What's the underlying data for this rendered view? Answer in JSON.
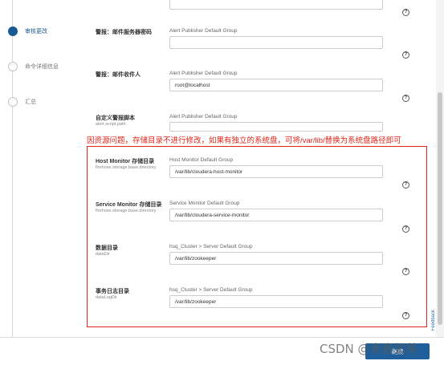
{
  "stepper": {
    "steps": [
      {
        "label": "审核更改",
        "active": true
      },
      {
        "label": "命令详细信息",
        "active": false
      },
      {
        "label": "汇总",
        "active": false
      }
    ]
  },
  "config": {
    "top_field_value": "",
    "email_server": {
      "label": "警报：邮件服务器密码",
      "group": "Alert Publisher Default Group",
      "value": ""
    },
    "email_recipient": {
      "label": "警报：邮件收件人",
      "group": "Alert Publisher Default Group",
      "value": "root@localhost"
    },
    "custom_script": {
      "label": "自定义警报脚本",
      "sublabel": "alert.script.path",
      "group": "Alert Publisher Default Group"
    },
    "host_monitor": {
      "label": "Host Monitor 存储目录",
      "sublabel": "firehose.storage.base.directory",
      "group": "Host Monitor Default Group",
      "value": "/var/lib/cloudera-host-monitor"
    },
    "service_monitor": {
      "label": "Service Monitor 存储目录",
      "sublabel": "firehose.storage.base.directory",
      "group": "Service Monitor Default Group",
      "value": "/var/lib/cloudera-service-monitor"
    },
    "data_dir": {
      "label": "数据目录",
      "sublabel": "dataDir",
      "group": "hsq_Cluster > Server Default Group",
      "value": "/var/lib/zookeeper"
    },
    "data_log_dir": {
      "label": "事务日志目录",
      "sublabel": "dataLogDir",
      "group": "hsq_Cluster > Server Default Group",
      "value": "/var/lib/zookeeper"
    }
  },
  "help_glyph": "?",
  "annotation": {
    "text": "因资源问题，存储目录不进行修改，如果有独立的系统盘，可将/var/lib/替换为系统盘路径即可",
    "color": "#e0261a"
  },
  "feedback_label": "Feedback",
  "footer": {
    "continue_label": "继续",
    "watermark": "CSDN @青春如茶"
  },
  "colors": {
    "accent": "#1a5a92",
    "button": "#1e5f9b",
    "annotation": "#e0261a"
  }
}
